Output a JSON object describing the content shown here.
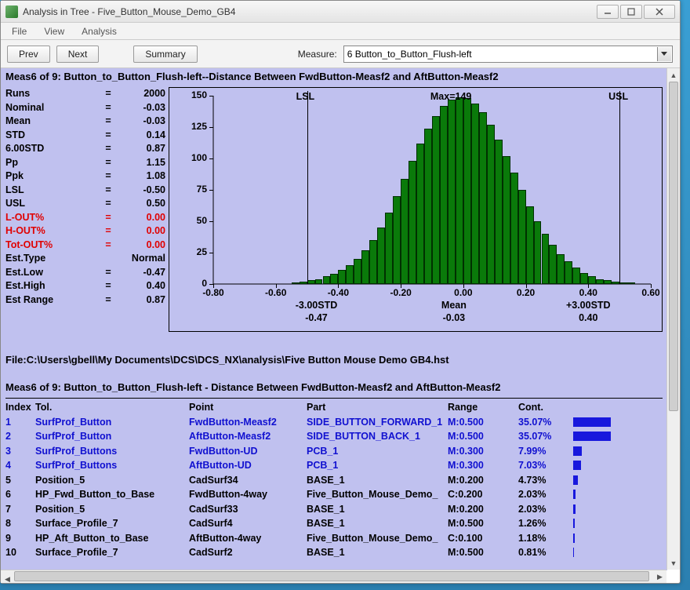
{
  "window": {
    "title": "Analysis in Tree - Five_Button_Mouse_Demo_GB4"
  },
  "menu": {
    "file": "File",
    "view": "View",
    "analysis": "Analysis"
  },
  "toolbar": {
    "prev": "Prev",
    "next": "Next",
    "summary": "Summary",
    "measure_label": "Measure:",
    "measure_value": "6 Button_to_Button_Flush-left"
  },
  "header_line": "Meas6 of 9: Button_to_Button_Flush-left--Distance Between FwdButton-Measf2 and AftButton-Measf2",
  "stats": [
    {
      "label": "Runs",
      "eq": "=",
      "value": "2000",
      "red": false
    },
    {
      "label": "Nominal",
      "eq": "=",
      "value": "-0.03",
      "red": false
    },
    {
      "label": "Mean",
      "eq": "=",
      "value": "-0.03",
      "red": false
    },
    {
      "label": "STD",
      "eq": "=",
      "value": "0.14",
      "red": false
    },
    {
      "label": "6.00STD",
      "eq": "=",
      "value": "0.87",
      "red": false
    },
    {
      "label": "Pp",
      "eq": "=",
      "value": "1.15",
      "red": false
    },
    {
      "label": "Ppk",
      "eq": "=",
      "value": "1.08",
      "red": false
    },
    {
      "label": "LSL",
      "eq": "=",
      "value": "-0.50",
      "red": false
    },
    {
      "label": "USL",
      "eq": "=",
      "value": "0.50",
      "red": false
    },
    {
      "label": "L-OUT%",
      "eq": "=",
      "value": "0.00",
      "red": true
    },
    {
      "label": "H-OUT%",
      "eq": "=",
      "value": "0.00",
      "red": true
    },
    {
      "label": "Tot-OUT%",
      "eq": "=",
      "value": "0.00",
      "red": true
    },
    {
      "label": "Est.Type",
      "eq": "",
      "value": "Normal",
      "red": false
    },
    {
      "label": "Est.Low",
      "eq": "=",
      "value": "-0.47",
      "red": false
    },
    {
      "label": "Est.High",
      "eq": "=",
      "value": "0.40",
      "red": false
    },
    {
      "label": "Est Range",
      "eq": "=",
      "value": "0.87",
      "red": false
    }
  ],
  "chart_data": {
    "type": "bar",
    "title_max": "Max=149",
    "lsl_label": "LSL",
    "usl_label": "USL",
    "yticks": [
      150,
      125,
      100,
      75,
      50,
      25,
      0
    ],
    "ylim": [
      0,
      150
    ],
    "xticks": [
      "-0.80",
      "-0.60",
      "-0.40",
      "-0.20",
      "0.00",
      "0.20",
      "0.40",
      "0.60"
    ],
    "xrange": [
      -0.8,
      0.6
    ],
    "sub_labels": {
      "left": {
        "line1": "-3.00STD",
        "line2": "-0.47"
      },
      "mid": {
        "line1": "Mean",
        "line2": "-0.03"
      },
      "right": {
        "line1": "+3.00STD",
        "line2": "0.40"
      }
    },
    "lsl_x": -0.5,
    "usl_x": 0.5,
    "bin_start": -0.55,
    "bin_width": 0.025,
    "values": [
      1,
      2,
      3,
      4,
      6,
      8,
      11,
      15,
      20,
      27,
      35,
      45,
      57,
      70,
      84,
      98,
      112,
      124,
      134,
      142,
      147,
      149,
      148,
      144,
      137,
      127,
      115,
      102,
      89,
      75,
      62,
      50,
      40,
      31,
      24,
      18,
      13,
      9,
      6,
      4,
      3,
      2,
      1,
      1
    ]
  },
  "file_line": "File:C:\\Users\\gbell\\My Documents\\DCS\\DCS_NX\\analysis\\Five Button Mouse Demo GB4.hst",
  "header2_line": "Meas6 of 9: Button_to_Button_Flush-left - Distance Between FwdButton-Measf2 and AftButton-Measf2",
  "grid": {
    "head": {
      "idx": "Index",
      "tol": "Tol.",
      "point": "Point",
      "part": "Part",
      "range": "Range",
      "cont": "Cont."
    },
    "rows": [
      {
        "idx": "1",
        "tol": "SurfProf_Button",
        "point": "FwdButton-Measf2",
        "part": "SIDE_BUTTON_FORWARD_1",
        "range": "M:0.500",
        "cont": "35.07%",
        "bar": 35.07,
        "hl": true
      },
      {
        "idx": "2",
        "tol": "SurfProf_Button",
        "point": "AftButton-Measf2",
        "part": "SIDE_BUTTON_BACK_1",
        "range": "M:0.500",
        "cont": "35.07%",
        "bar": 35.07,
        "hl": true
      },
      {
        "idx": "3",
        "tol": "SurfProf_Buttons",
        "point": "FwdButton-UD",
        "part": "PCB_1",
        "range": "M:0.300",
        "cont": "7.99%",
        "bar": 7.99,
        "hl": true
      },
      {
        "idx": "4",
        "tol": "SurfProf_Buttons",
        "point": "AftButton-UD",
        "part": "PCB_1",
        "range": "M:0.300",
        "cont": "7.03%",
        "bar": 7.03,
        "hl": true
      },
      {
        "idx": "5",
        "tol": "Position_5",
        "point": "CadSurf34",
        "part": "BASE_1",
        "range": "M:0.200",
        "cont": "4.73%",
        "bar": 4.73,
        "hl": false
      },
      {
        "idx": "6",
        "tol": "HP_Fwd_Button_to_Base",
        "point": "FwdButton-4way",
        "part": "Five_Button_Mouse_Demo_",
        "range": "C:0.200",
        "cont": "2.03%",
        "bar": 2.03,
        "hl": false
      },
      {
        "idx": "7",
        "tol": "Position_5",
        "point": "CadSurf33",
        "part": "BASE_1",
        "range": "M:0.200",
        "cont": "2.03%",
        "bar": 2.03,
        "hl": false
      },
      {
        "idx": "8",
        "tol": "Surface_Profile_7",
        "point": "CadSurf4",
        "part": "BASE_1",
        "range": "M:0.500",
        "cont": "1.26%",
        "bar": 1.26,
        "hl": false
      },
      {
        "idx": "9",
        "tol": "HP_Aft_Button_to_Base",
        "point": "AftButton-4way",
        "part": "Five_Button_Mouse_Demo_",
        "range": "C:0.100",
        "cont": "1.18%",
        "bar": 1.18,
        "hl": false
      },
      {
        "idx": "10",
        "tol": "Surface_Profile_7",
        "point": "CadSurf2",
        "part": "BASE_1",
        "range": "M:0.500",
        "cont": "0.81%",
        "bar": 0.81,
        "hl": false
      }
    ]
  }
}
